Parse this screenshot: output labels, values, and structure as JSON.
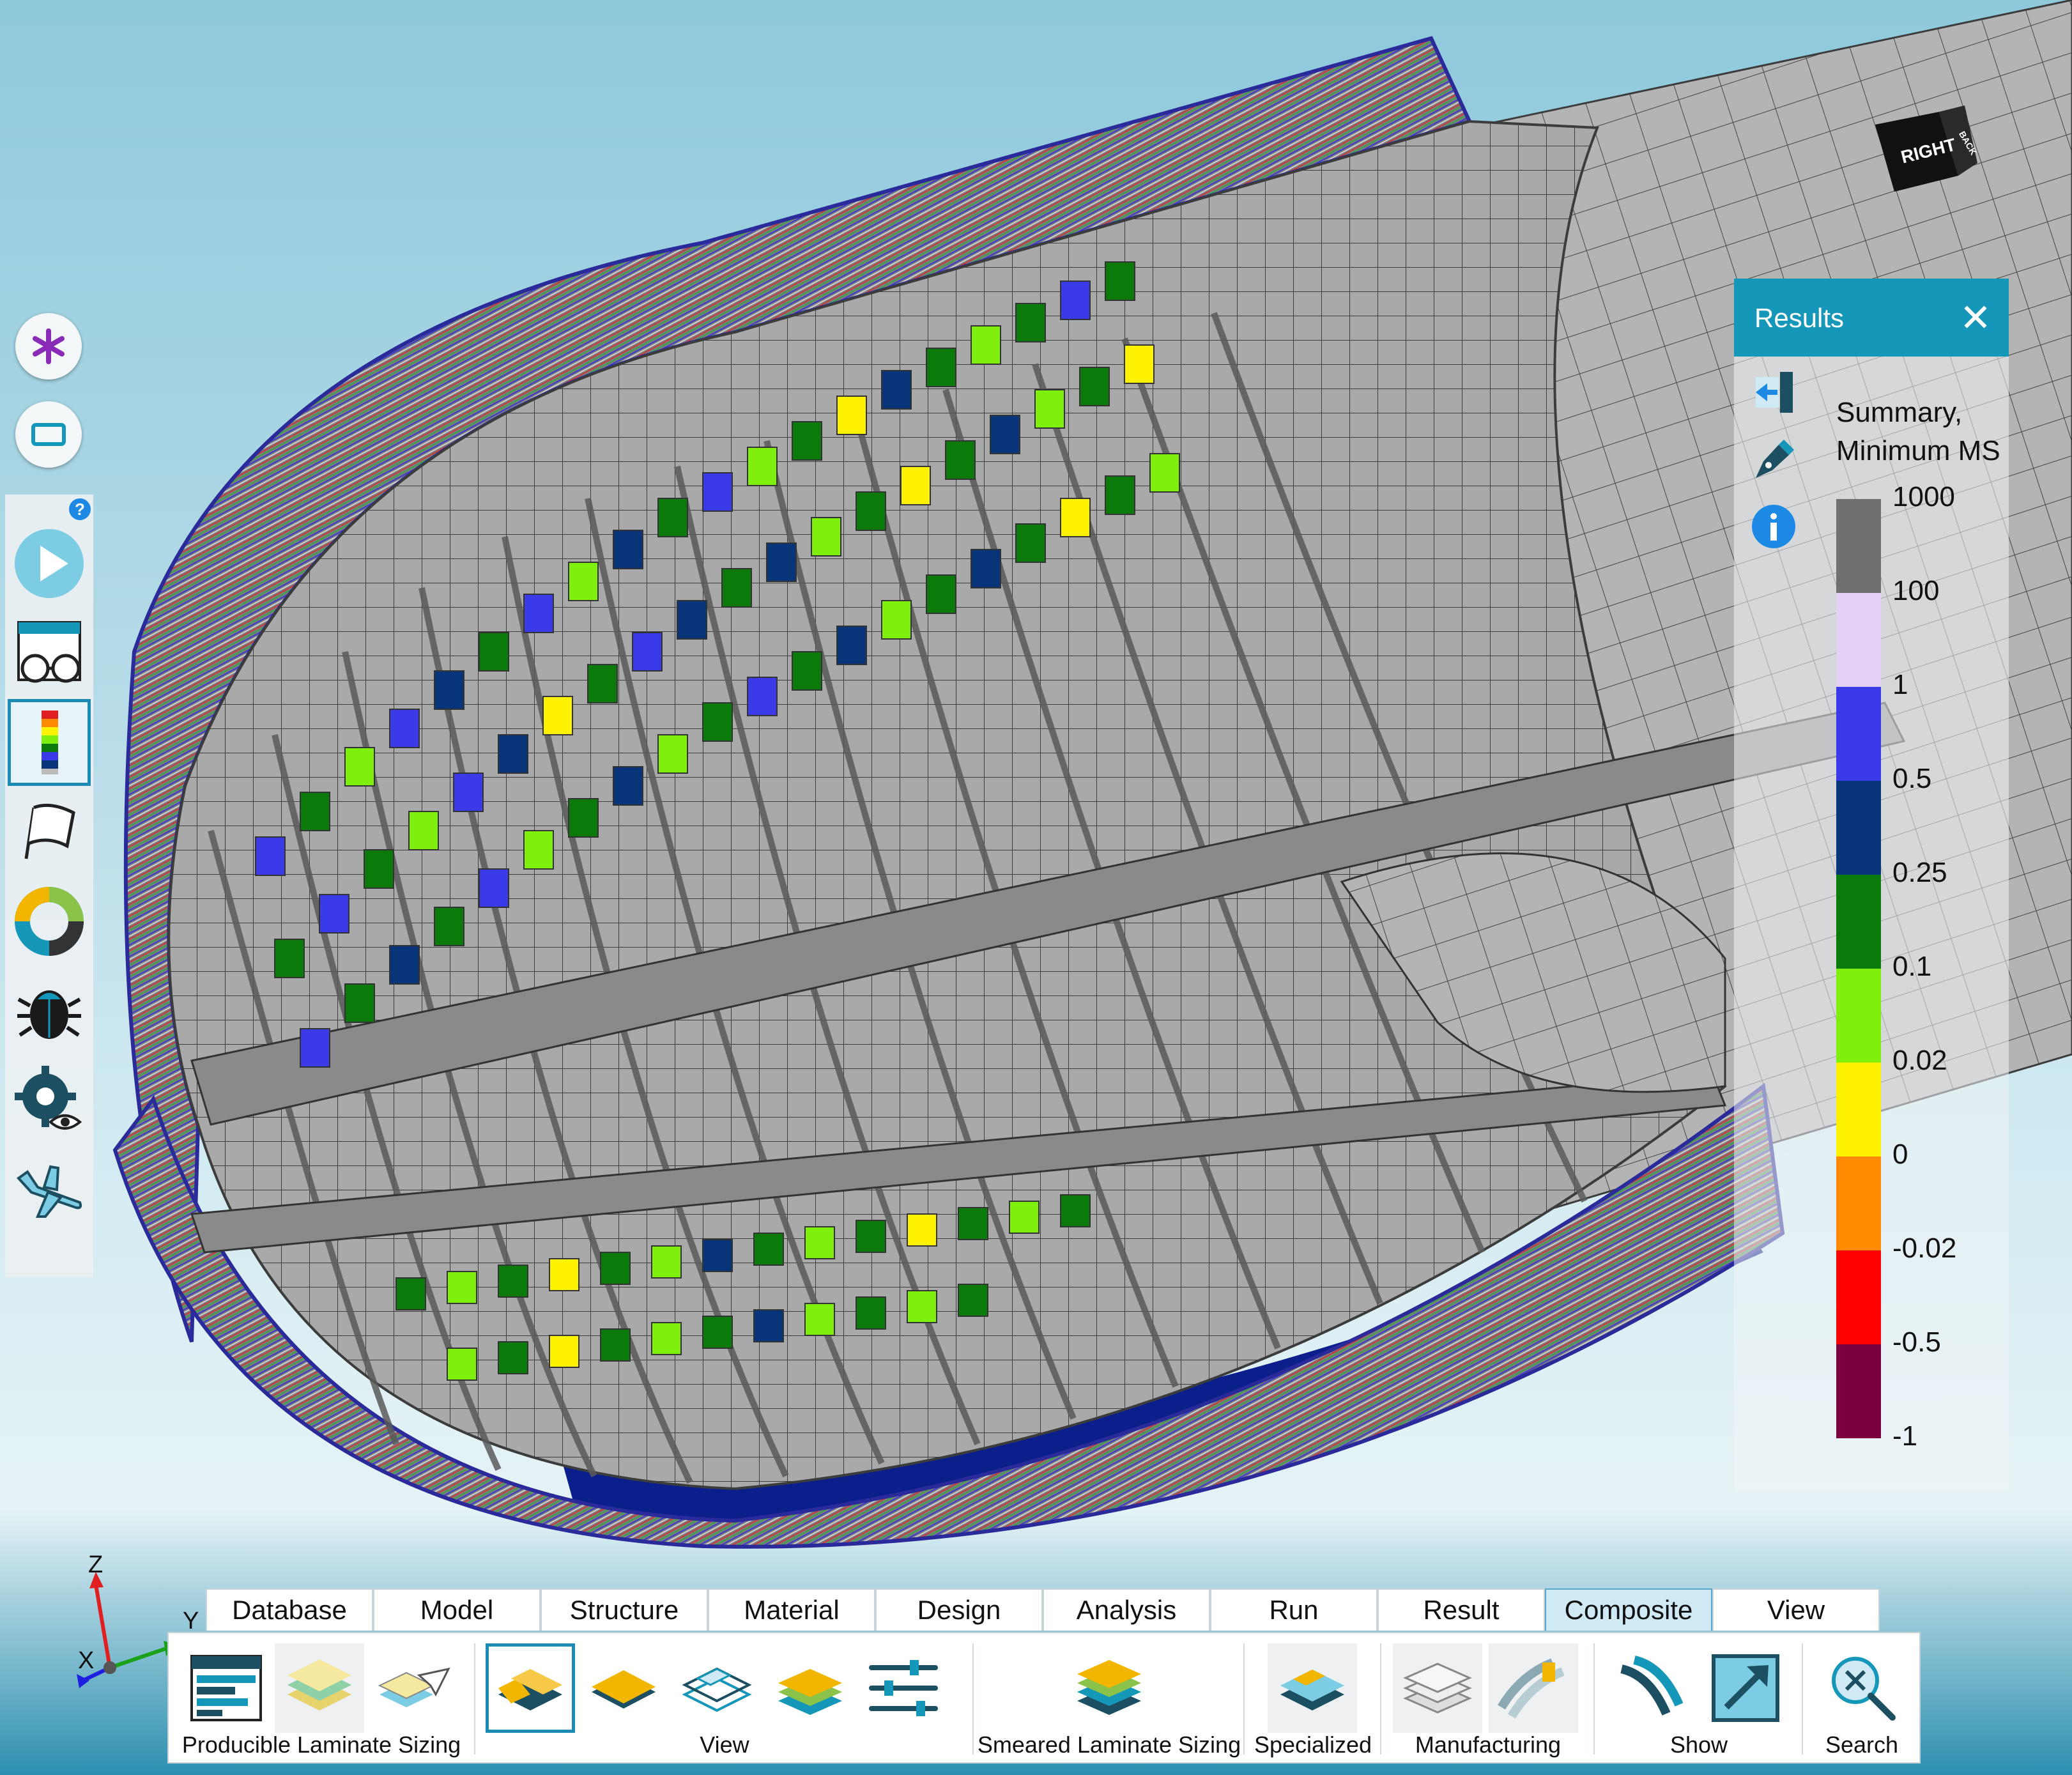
{
  "viewcube": {
    "face_main": "RIGHT",
    "face_side": "BACK"
  },
  "results_panel": {
    "title": "Results",
    "close_icon": "close-icon",
    "legend_title_line1": "Summary,",
    "legend_title_line2": "Minimum MS",
    "legend": [
      {
        "label": "1000",
        "color": "#707070"
      },
      {
        "label": "100",
        "color": "#e3d2f5"
      },
      {
        "label": "1",
        "color": "#3a3ae8"
      },
      {
        "label": "0.5",
        "color": "#08357a"
      },
      {
        "label": "0.25",
        "color": "#0a7a0a"
      },
      {
        "label": "0.1",
        "color": "#7ff00e"
      },
      {
        "label": "0.02",
        "color": "#fff200"
      },
      {
        "label": "0",
        "color": "#ff8a00"
      },
      {
        "label": "-0.02",
        "color": "#ff0000"
      },
      {
        "label": "-0.5",
        "color": "#7a0040"
      },
      {
        "label": "-1",
        "color": ""
      }
    ]
  },
  "axis": {
    "z": "Z",
    "y": "Y",
    "x": "X"
  },
  "tabs": [
    {
      "label": "Database"
    },
    {
      "label": "Model"
    },
    {
      "label": "Structure"
    },
    {
      "label": "Material"
    },
    {
      "label": "Design"
    },
    {
      "label": "Analysis"
    },
    {
      "label": "Run"
    },
    {
      "label": "Result"
    },
    {
      "label": "Composite",
      "active": true
    },
    {
      "label": "View"
    }
  ],
  "ribbon": {
    "producible_label": "Producible Laminate Sizing",
    "view_label": "View",
    "smeared_label": "Smeared Laminate Sizing",
    "specialized_label": "Specialized",
    "manufacturing_label": "Manufacturing",
    "show_label": "Show",
    "search_label": "Search"
  },
  "colors": {
    "accent": "#1597b9",
    "panel_grey": "#a8a8a8",
    "mesh_line": "#3c3c3c"
  }
}
